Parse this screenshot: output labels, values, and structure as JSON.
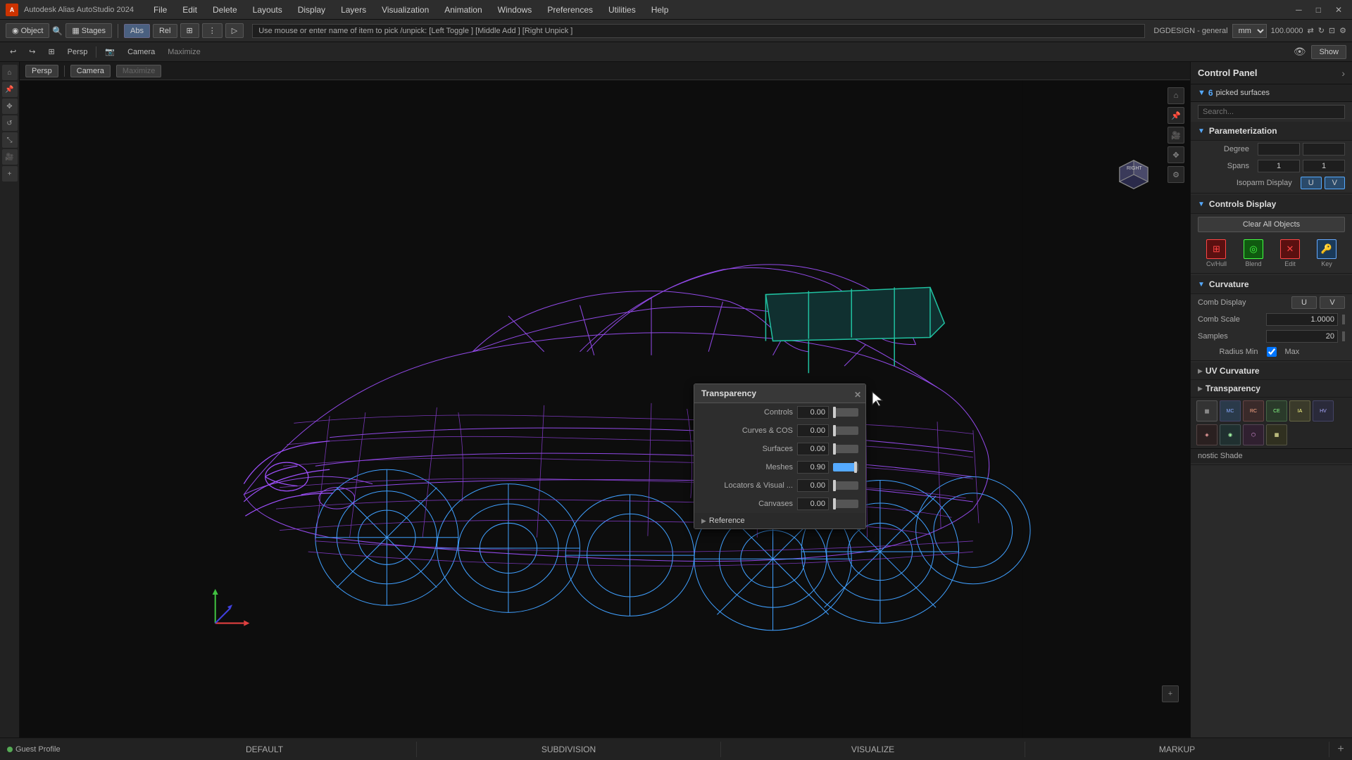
{
  "app": {
    "title": "Autodesk Alias AutoStudio 2024",
    "logo_text": "A"
  },
  "menu": {
    "items": [
      "File",
      "Edit",
      "Delete",
      "Layouts",
      "Display",
      "Layers",
      "Visualization",
      "Animation",
      "Windows",
      "Preferences",
      "Utilities",
      "Help"
    ]
  },
  "toolbar": {
    "object_label": "Object",
    "stages_label": "Stages",
    "abs_label": "Abs",
    "rel_label": "Rel",
    "status_text": "Use mouse or enter name of item to pick /unpick: [Left Toggle ] [Middle Add ] [Right Unpick ]",
    "design_label": "DGDESIGN - general",
    "unit_label": "mm",
    "value_label": "100.0000"
  },
  "viewport": {
    "projection": "Persp",
    "camera": "Camera",
    "maximize": "Maximize",
    "show_label": "Show"
  },
  "control_panel": {
    "title": "Control Panel",
    "picked_surfaces": {
      "count": "6",
      "label": "picked surfaces"
    },
    "parameterization": {
      "title": "Parameterization",
      "degree_label": "Degree",
      "spans_label": "Spans",
      "spans_u": "1",
      "spans_v": "1",
      "isoparm_label": "Isoparm Display",
      "isoparm_u": "U",
      "isoparm_v": "V"
    },
    "controls_display": {
      "title": "Controls Display",
      "clear_all_label": "Clear All Objects",
      "icons": [
        {
          "label": "Cv/Hull",
          "symbol": "⊞",
          "color": "red"
        },
        {
          "label": "Blend",
          "symbol": "◎",
          "color": "green"
        },
        {
          "label": "Edit",
          "symbol": "✕",
          "color": "red"
        },
        {
          "label": "Key",
          "symbol": "🔑",
          "color": "blue"
        }
      ]
    },
    "curvature": {
      "title": "Curvature",
      "comb_display_label": "Comb Display",
      "comb_u": "U",
      "comb_v": "V",
      "comb_scale_label": "Comb Scale",
      "comb_scale_value": "1.0000",
      "samples_label": "Samples",
      "samples_value": "20",
      "radius_min_label": "Radius Min",
      "radius_max_label": "Max"
    },
    "uv_curvature": {
      "title": "UV Curvature"
    },
    "transparency_section": {
      "title": "Transparency"
    },
    "diagnostic_shade": {
      "title": "nostic Shade",
      "icons": [
        "Off",
        "MulCol",
        "RanCol",
        "CurEvl",
        "IsoAng",
        "HorVer"
      ]
    },
    "reference": {
      "title": "Reference"
    }
  },
  "transparency_popup": {
    "title": "Transparency",
    "rows": [
      {
        "label": "Controls",
        "value": "0.00",
        "fill_pct": 0
      },
      {
        "label": "Curves & COS",
        "value": "0.00",
        "fill_pct": 0
      },
      {
        "label": "Surfaces",
        "value": "0.00",
        "fill_pct": 0
      },
      {
        "label": "Meshes",
        "value": "0.90",
        "fill_pct": 90
      },
      {
        "label": "Locators & Visual ...",
        "value": "0.00",
        "fill_pct": 0
      },
      {
        "label": "Canvases",
        "value": "0.00",
        "fill_pct": 0
      }
    ],
    "reference_label": "Reference"
  },
  "status_bar": {
    "guest_label": "Guest Profile",
    "items": [
      "DEFAULT",
      "SUBDIVISION",
      "VISUALIZE",
      "MARKUP"
    ],
    "plus": "+"
  },
  "icons": {
    "chevron_down": "▼",
    "chevron_right": "▶",
    "close": "✕",
    "search": "🔍",
    "eye": "👁",
    "home": "⌂",
    "pin": "📌",
    "gear": "⚙",
    "plus": "+",
    "minus": "−",
    "cube": "◼"
  }
}
